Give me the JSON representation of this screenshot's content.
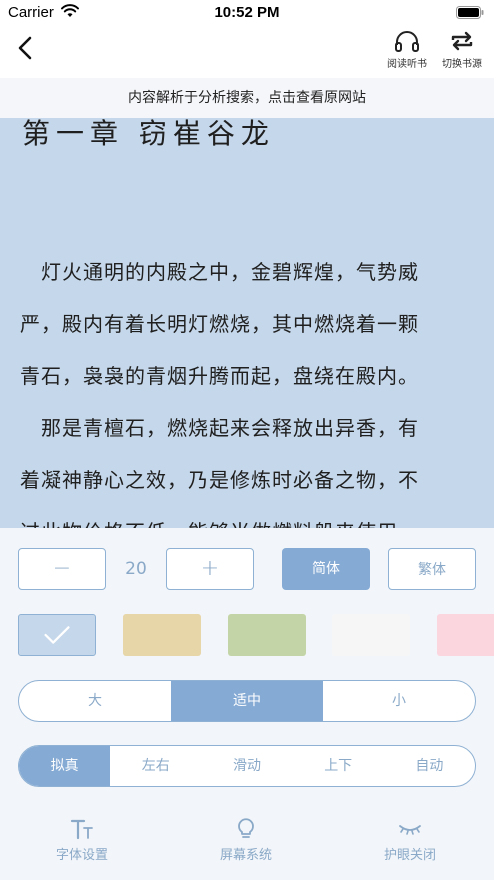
{
  "status_bar": {
    "carrier": "Carrier",
    "time": "10:52 PM"
  },
  "nav": {
    "back_icon": "chevron-left-icon",
    "listen_label": "阅读听书",
    "switch_source_label": "切换书源"
  },
  "notice": "内容解析于分析搜索，点击查看原网站",
  "reader": {
    "background": "#c5d7ea",
    "chapter_title": "第一章 窃崔谷龙",
    "lines": [
      "　灯火通明的内殿之中，金碧辉煌，气势威",
      "严，殿内有着长明灯燃烧，其中燃烧着一颗",
      "青石，袅袅的青烟升腾而起，盘绕在殿内。",
      "　那是青檀石，燃烧起来会释放出异香，有",
      "着凝神静心之效，乃是修炼时必备之物，不",
      "过此物价格不低，能够当做燃料般来使用，"
    ]
  },
  "settings": {
    "font_size": {
      "decrease_glyph": "−",
      "value": "20",
      "increase_glyph": "+"
    },
    "script": {
      "simplified": "简体",
      "traditional": "繁体",
      "selected": "simplified"
    },
    "themes": [
      {
        "name": "blue",
        "color": "#c5d7ea",
        "selected": true
      },
      {
        "name": "parchment",
        "color": "#e6d6a8",
        "selected": false
      },
      {
        "name": "green",
        "color": "#c3d5a6",
        "selected": false
      },
      {
        "name": "white",
        "color": "#f6f6f6",
        "selected": false
      },
      {
        "name": "pink",
        "color": "#fbd6df",
        "selected": false
      }
    ],
    "spacing": {
      "options": [
        "大",
        "适中",
        "小"
      ],
      "selected": "适中"
    },
    "page_turn": {
      "options": [
        "拟真",
        "左右",
        "滑动",
        "上下",
        "自动"
      ],
      "selected": "拟真"
    }
  },
  "bottom_tabs": {
    "font": {
      "label": "字体设置",
      "icon": "font-size-icon"
    },
    "screen": {
      "label": "屏幕系统",
      "icon": "lightbulb-icon"
    },
    "eye": {
      "label": "护眼关闭",
      "icon": "closed-eye-icon"
    }
  },
  "colors": {
    "accent": "#85aad4",
    "accent_text": "#8aa9c8",
    "border": "#8fb1d3"
  }
}
